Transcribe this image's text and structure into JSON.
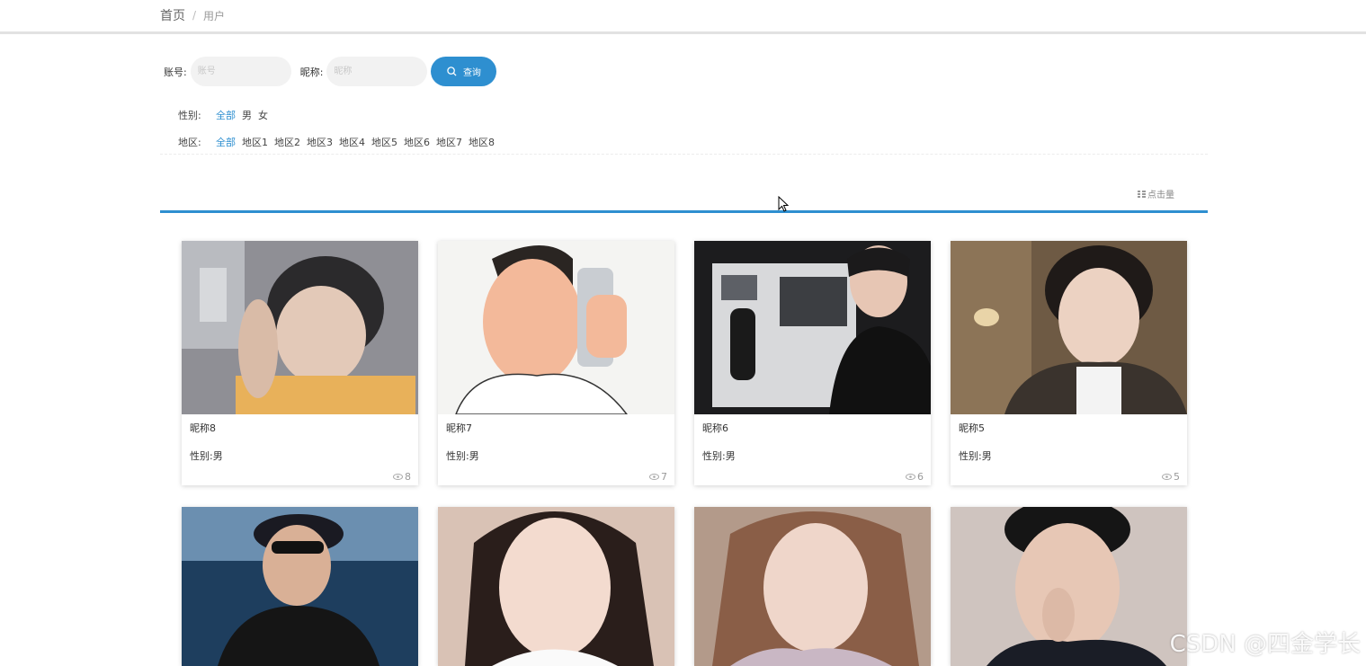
{
  "breadcrumb": {
    "home": "首页",
    "separator": "/",
    "current": "用户"
  },
  "search": {
    "account_label": "账号:",
    "account_placeholder": "账号",
    "nickname_label": "昵称:",
    "nickname_placeholder": "昵称",
    "button_label": "查询",
    "button_color": "#2e8fd0"
  },
  "filters": {
    "gender": {
      "label": "性别:",
      "options": [
        "全部",
        "男",
        "女"
      ],
      "selected": "全部"
    },
    "region": {
      "label": "地区:",
      "options": [
        "全部",
        "地区1",
        "地区2",
        "地区3",
        "地区4",
        "地区5",
        "地区6",
        "地区7",
        "地区8"
      ],
      "selected": "全部"
    }
  },
  "sort": {
    "label": "点击量"
  },
  "users": [
    {
      "nickname": "昵称8",
      "gender": "性别:男",
      "views": "8"
    },
    {
      "nickname": "昵称7",
      "gender": "性别:男",
      "views": "7"
    },
    {
      "nickname": "昵称6",
      "gender": "性别:男",
      "views": "6"
    },
    {
      "nickname": "昵称5",
      "gender": "性别:男",
      "views": "5"
    }
  ],
  "watermark": "CSDN @四金学长",
  "accent_color": "#2e8fd0"
}
